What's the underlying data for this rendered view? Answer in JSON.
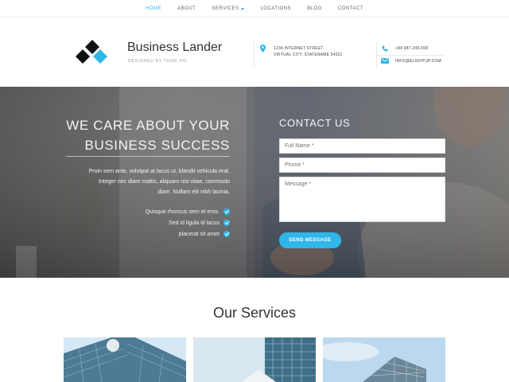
{
  "nav": {
    "items": [
      {
        "label": "HOME",
        "active": true
      },
      {
        "label": "ABOUT"
      },
      {
        "label": "SERVICES",
        "dropdown": true
      },
      {
        "label": "LOCATIONS"
      },
      {
        "label": "BLOG"
      },
      {
        "label": "CONTACT"
      }
    ]
  },
  "header": {
    "brand_name": "Business Lander",
    "brand_tagline": "DESIGNED BY TUNG DO",
    "address_line1": "1234 INTERNET STREET",
    "address_line2": "VIRTUAL CITY, STATENAME 54321",
    "phone": "+84 987-245-558",
    "email": "INFO@ELIGHTUP.COM"
  },
  "hero": {
    "title_line1": "WE CARE ABOUT YOUR",
    "title_line2": "BUSINESS SUCCESS",
    "desc_line1": "Proin sem ante, volutpat at lacus ut, blandit vehicula erat.",
    "desc_line2": "Integer nec diam mattis, aliquam nisi vitae, commodo",
    "desc_line3": "diam. Nullam elit nibh lacinia.",
    "checks": [
      "Quisque rhoncus sem et eros.",
      "Sed id ligula id lacus",
      "placerat sit amet"
    ]
  },
  "form": {
    "title": "CONTACT US",
    "name_placeholder": "Full Name *",
    "phone_placeholder": "Phone *",
    "message_placeholder": "Message *",
    "submit_label": "SEND MESSAGE"
  },
  "services": {
    "title": "Our Services"
  },
  "colors": {
    "accent": "#30b6e8",
    "text_dark": "#333333",
    "hero_overlay": "#5f6268"
  },
  "icons": {
    "address": "map-pin-icon",
    "phone": "phone-icon",
    "email": "envelope-icon",
    "check": "check-circle-icon"
  }
}
